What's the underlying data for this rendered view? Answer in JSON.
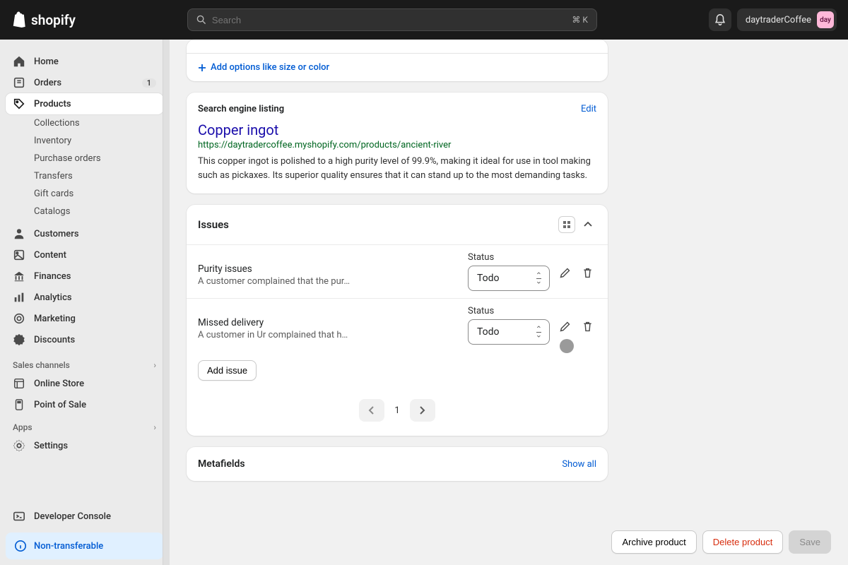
{
  "topbar": {
    "brand": "shopify",
    "search_placeholder": "Search",
    "search_kbd": "⌘ K",
    "store_name": "daytraderCoffee",
    "avatar_initials": "day"
  },
  "sidebar": {
    "items": [
      {
        "label": "Home",
        "icon": "home"
      },
      {
        "label": "Orders",
        "icon": "orders",
        "badge": "1"
      },
      {
        "label": "Products",
        "icon": "products",
        "active": true
      }
    ],
    "products_sub": [
      {
        "label": "Collections"
      },
      {
        "label": "Inventory"
      },
      {
        "label": "Purchase orders"
      },
      {
        "label": "Transfers"
      },
      {
        "label": "Gift cards"
      },
      {
        "label": "Catalogs"
      }
    ],
    "items2": [
      {
        "label": "Customers",
        "icon": "customers"
      },
      {
        "label": "Content",
        "icon": "content"
      },
      {
        "label": "Finances",
        "icon": "finances"
      },
      {
        "label": "Analytics",
        "icon": "analytics"
      },
      {
        "label": "Marketing",
        "icon": "marketing"
      },
      {
        "label": "Discounts",
        "icon": "discounts"
      }
    ],
    "sales_channels": "Sales channels",
    "channels": [
      {
        "label": "Online Store"
      },
      {
        "label": "Point of Sale"
      }
    ],
    "apps": "Apps",
    "settings": "Settings",
    "developer": "Developer Console",
    "non_transferable": "Non-transferable"
  },
  "options_card": {
    "add_options": "Add options like size or color"
  },
  "seo": {
    "section_title": "Search engine listing",
    "edit": "Edit",
    "title": "Copper ingot",
    "url": "https://daytradercoffee.myshopify.com/products/ancient-river",
    "description": "This copper ingot is polished to a high purity level of 99.9%, making it ideal for use in tool making such as pickaxes. Its superior quality ensures that it can stand up to the most demanding tasks."
  },
  "issues": {
    "title": "Issues",
    "status_label": "Status",
    "rows": [
      {
        "title": "Purity issues",
        "desc": "A customer complained that the pur…",
        "status": "Todo"
      },
      {
        "title": "Missed delivery",
        "desc": "A customer in Ur complained that h…",
        "status": "Todo"
      }
    ],
    "add_issue": "Add issue",
    "page": "1"
  },
  "metafields": {
    "title": "Metafields",
    "show_all": "Show all"
  },
  "footer": {
    "archive": "Archive product",
    "delete": "Delete product",
    "save": "Save"
  }
}
